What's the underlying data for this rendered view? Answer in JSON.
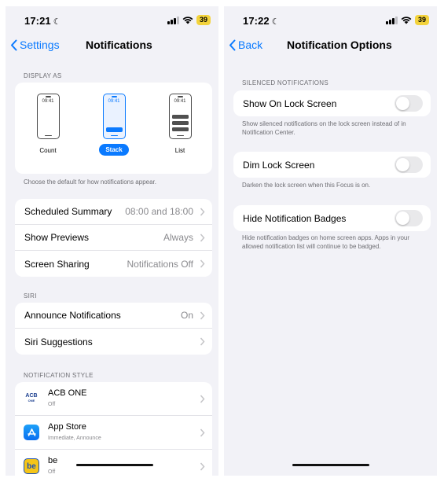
{
  "left": {
    "status": {
      "time": "17:21",
      "battery": "39"
    },
    "nav": {
      "back": "Settings",
      "title": "Notifications"
    },
    "display_as": {
      "header": "DISPLAY AS",
      "options": [
        {
          "label": "Count",
          "clock": "09:41"
        },
        {
          "label": "Stack",
          "clock": "09:41",
          "selected": true
        },
        {
          "label": "List",
          "clock": "09:41"
        }
      ],
      "footer": "Choose the default for how notifications appear."
    },
    "settings_rows": [
      {
        "label": "Scheduled Summary",
        "value": "08:00 and 18:00"
      },
      {
        "label": "Show Previews",
        "value": "Always"
      },
      {
        "label": "Screen Sharing",
        "value": "Notifications Off"
      }
    ],
    "siri": {
      "header": "SIRI",
      "rows": [
        {
          "label": "Announce Notifications",
          "value": "On"
        },
        {
          "label": "Siri Suggestions",
          "value": ""
        }
      ]
    },
    "notification_style": {
      "header": "NOTIFICATION STYLE",
      "apps": [
        {
          "name": "ACB ONE",
          "sub": "Off",
          "icon_text": "ACB",
          "icon_sub": "ONE"
        },
        {
          "name": "App Store",
          "sub": "Immediate, Announce",
          "icon": "app-store-icon"
        },
        {
          "name": "be",
          "sub": "Off",
          "icon_text": "be"
        }
      ]
    }
  },
  "right": {
    "status": {
      "time": "17:22",
      "battery": "39"
    },
    "nav": {
      "back": "Back",
      "title": "Notification Options"
    },
    "silenced": {
      "header": "SILENCED NOTIFICATIONS",
      "items": [
        {
          "label": "Show On Lock Screen",
          "on": false,
          "footer": "Show silenced notifications on the lock screen instead of in Notification Center."
        },
        {
          "label": "Dim Lock Screen",
          "on": false,
          "footer": "Darken the lock screen when this Focus is on."
        },
        {
          "label": "Hide Notification Badges",
          "on": false,
          "footer": "Hide notification badges on home screen apps. Apps in your allowed notification list will continue to be badged."
        }
      ]
    }
  },
  "colors": {
    "accent": "#0a7aff",
    "battery": "#f3d33c",
    "background": "#f2f2f7"
  }
}
